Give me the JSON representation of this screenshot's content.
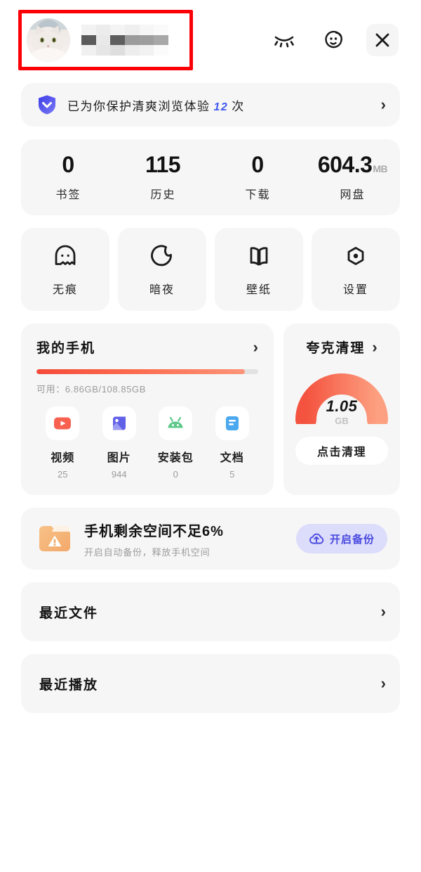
{
  "header": {
    "avatar_name": "cat-avatar-photo",
    "username_redacted": true,
    "actions": [
      {
        "name": "closed-eye-icon",
        "label": "无痕模式"
      },
      {
        "name": "smiley-feedback-icon",
        "label": "反馈"
      },
      {
        "name": "close-icon",
        "label": "关闭"
      }
    ],
    "annotation_color": "#fb0007"
  },
  "protect": {
    "icon": "shield-check-icon",
    "text_before": "已为你保护清爽浏览体验",
    "count": "12",
    "text_after": "次",
    "chevron": "›",
    "accent_color": "#4159f0"
  },
  "stats": [
    {
      "value": "0",
      "unit": "",
      "label": "书签"
    },
    {
      "value": "115",
      "unit": "",
      "label": "历史"
    },
    {
      "value": "0",
      "unit": "",
      "label": "下载"
    },
    {
      "value": "604.3",
      "unit": "MB",
      "label": "网盘"
    }
  ],
  "quick_actions": [
    {
      "icon": "ghost-icon",
      "label": "无痕"
    },
    {
      "icon": "moon-icon",
      "label": "暗夜"
    },
    {
      "icon": "open-book-icon",
      "label": "壁纸"
    },
    {
      "icon": "hexagon-gear-icon",
      "label": "设置"
    }
  ],
  "phone_card": {
    "title": "我的手机",
    "chevron": "›",
    "progress_percent": 94,
    "available_text": "可用：6.86GB/108.85GB",
    "bar_color_start": "#f54b3a",
    "bar_color_end": "#fd9478",
    "file_types": [
      {
        "icon": "video-play-icon",
        "name": "视频",
        "count": "25",
        "color": "#f8604f"
      },
      {
        "icon": "image-icon",
        "name": "图片",
        "count": "944",
        "color": "#6161e8"
      },
      {
        "icon": "android-apk-icon",
        "name": "安装包",
        "count": "0",
        "color": "#5ec98b"
      },
      {
        "icon": "document-icon",
        "name": "文档",
        "count": "5",
        "color": "#4aa8ef"
      }
    ]
  },
  "clean_card": {
    "title": "夸克清理",
    "chevron": "›",
    "gauge_value": "1.05",
    "gauge_unit": "GB",
    "button_label": "点击清理",
    "gauge_color_start": "#f4533f",
    "gauge_color_end": "#fda081"
  },
  "backup_banner": {
    "icon": "folder-warning-icon",
    "title": "手机剩余空间不足6%",
    "subtitle": "开启自动备份，释放手机空间",
    "button_icon": "cloud-upload-icon",
    "button_label": "开启备份",
    "button_bg": "#dcdcfb",
    "button_fg": "#4a4ae0"
  },
  "rows": [
    {
      "label": "最近文件",
      "chevron": "›"
    },
    {
      "label": "最近播放",
      "chevron": "›"
    }
  ]
}
